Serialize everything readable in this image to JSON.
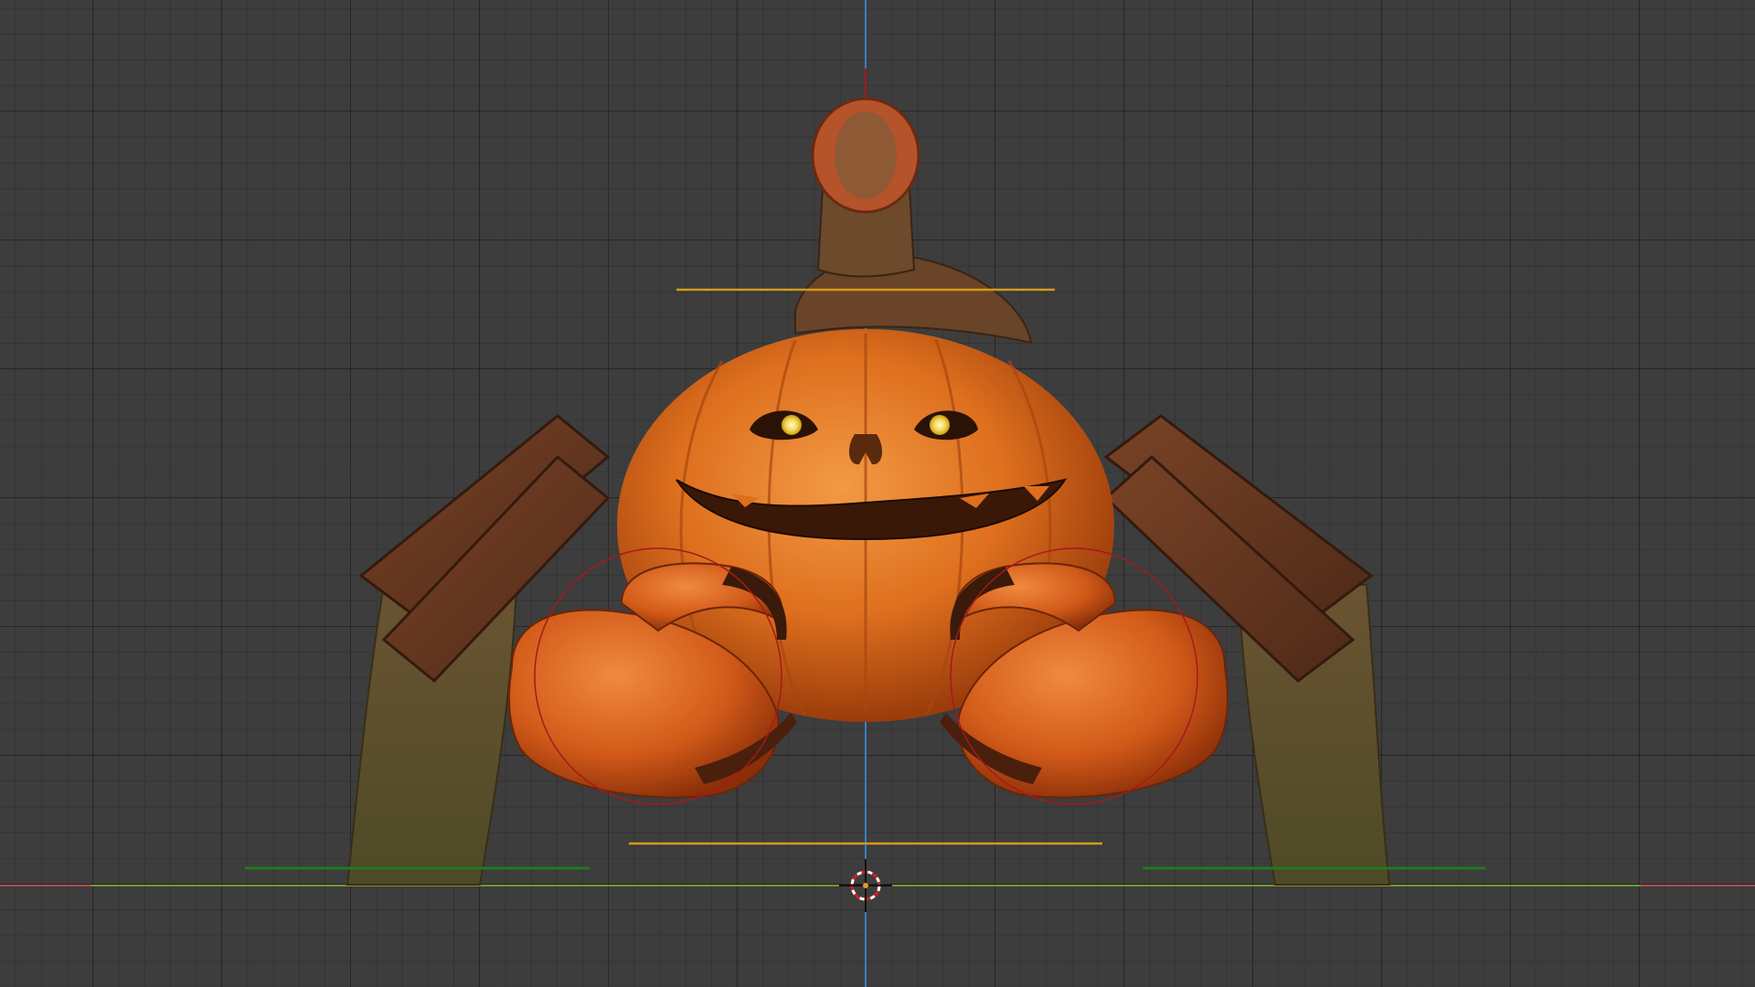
{
  "viewport": {
    "view": "front-orthographic",
    "grid_background": "#3d3d3d",
    "axis_colors": {
      "x": "#b24a55",
      "y": "#6f9a2a",
      "z": "#3a7fc0"
    },
    "object": "pumpkin-crab-model",
    "cursor_icon": "3d-cursor-icon"
  },
  "overlay_colors": {
    "bone_handle": "#d39a1e",
    "foot_marker": "#1f7a1f",
    "rig_circle": "#a8181c"
  }
}
